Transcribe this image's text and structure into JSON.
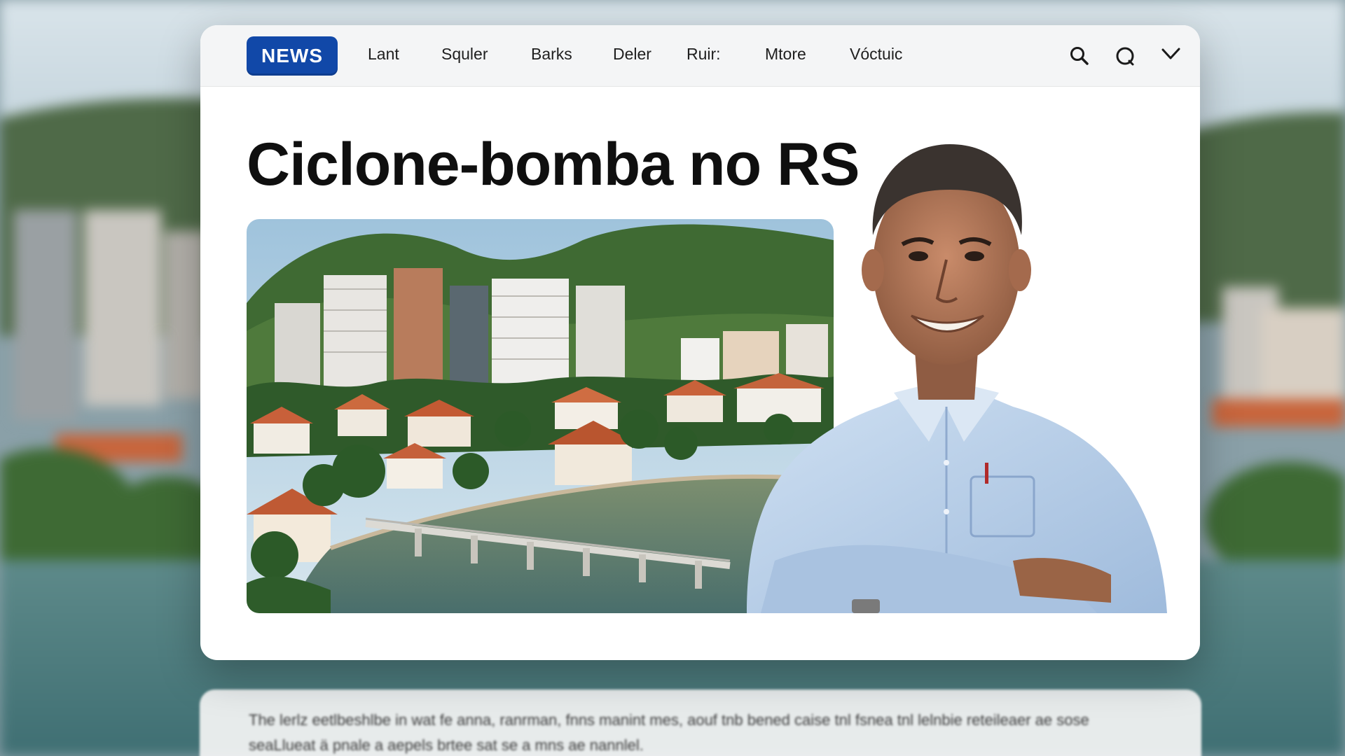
{
  "nav": {
    "logo": "NEWS",
    "items": [
      "Lant",
      "Squler",
      "Barks",
      "Deler",
      "Ruir:",
      "Mtore",
      "Vóctuic"
    ],
    "icons": [
      "search-icon",
      "chat-icon",
      "close-icon"
    ]
  },
  "article": {
    "headline": "Ciclone-bomba no RS"
  },
  "below_card": {
    "text": "The lerlz eetlbeshlbe in wat fe anna, ranrman, fnns manint mes, aouf tnb bened caise tnl fsnea tnl lelnbie reteileaer ae sose seaLlueat ä pnale a aepels brtee sat se a mns ae nannlel."
  },
  "colors": {
    "brand_blue": "#1148a8",
    "headline": "#0f0f0f",
    "card_bg": "#ffffff",
    "nav_bg": "#f4f5f6"
  }
}
